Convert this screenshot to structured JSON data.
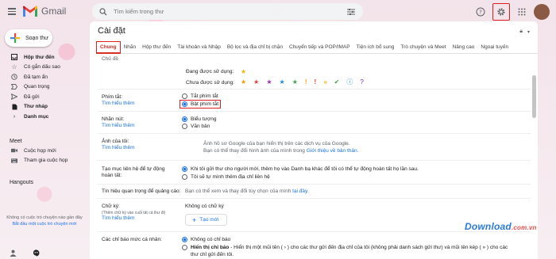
{
  "app": {
    "name": "Gmail"
  },
  "search": {
    "placeholder": "Tìm kiếm trong thư"
  },
  "sidebar": {
    "compose": "Soạn thư",
    "items": [
      {
        "label": "Hộp thư đến",
        "icon": "inbox-icon",
        "bold": true
      },
      {
        "label": "Có gắn dấu sao",
        "icon": "star-icon"
      },
      {
        "label": "Đã tạm ẩn",
        "icon": "clock-icon"
      },
      {
        "label": "Quan trọng",
        "icon": "important-icon"
      },
      {
        "label": "Đã gửi",
        "icon": "send-icon"
      },
      {
        "label": "Thư nháp",
        "icon": "draft-icon",
        "bold": true
      },
      {
        "label": "Danh mục",
        "icon": "chevron-right-icon",
        "bold": true
      }
    ],
    "meet": {
      "title": "Meet",
      "items": [
        {
          "label": "Cuộc họp mới",
          "icon": "video-icon"
        },
        {
          "label": "Tham gia cuộc họp",
          "icon": "keyboard-icon"
        }
      ]
    },
    "hangouts": {
      "title": "Hangouts",
      "empty": "Không có cuộc trò chuyện nào gần đây",
      "link": "Bắt đầu một cuộc trò chuyện mới"
    }
  },
  "settings": {
    "title": "Cài đặt",
    "tabs": [
      "Chung",
      "Nhãn",
      "Hộp thư đến",
      "Tài khoản và Nhập",
      "Bộ lọc và địa chỉ bị chặn",
      "Chuyển tiếp và POP/IMAP",
      "Tiện ích bổ sung",
      "Trò chuyện và Meet",
      "Nâng cao",
      "Ngoại tuyến"
    ],
    "active_tab": "Chung",
    "cutoff_text": "Chủ đề",
    "stars": {
      "in_use_label": "Đang được sử dụng:",
      "not_in_use_label": "Chưa được sử dụng:"
    },
    "shortcuts": {
      "label": "Phím tắt:",
      "learn_more": "Tìm hiểu thêm",
      "off": "Tắt phím tắt",
      "on": "Bật phím tắt"
    },
    "button_labels": {
      "label": "Nhãn nút:",
      "learn_more": "Tìm hiểu thêm",
      "icons": "Biểu tượng",
      "text": "Văn bản"
    },
    "my_picture": {
      "label": "Ảnh của tôi:",
      "learn_more": "Tìm hiểu thêm",
      "line1": "Ảnh hồ sơ Google của bạn hiển thị trên các dịch vụ của Google.",
      "line2_prefix": "Bạn có thể thay đổi hình ảnh của mình trong ",
      "line2_link": "Giới thiệu về bản thân."
    },
    "autocomplete": {
      "label": "Tạo mục liên hệ để tự động hoàn tất:",
      "opt1": "Khi tôi gửi thư cho người mới, thêm họ vào Danh bạ khác để tôi có thể tự động hoàn tất họ lần sau.",
      "opt2": "Tôi sẽ tự mình thêm địa chỉ liên hệ"
    },
    "ads": {
      "label": "Tín hiệu quan trọng để quảng cáo:",
      "text_prefix": "Bạn có thể xem và thay đổi tùy chọn của mình ",
      "link": "tại đây."
    },
    "signature": {
      "label": "Chữ ký:",
      "sub": "(Thêm chữ ký vào cuối tất cả thư đi)",
      "learn_more": "Tìm hiểu thêm",
      "none": "Không có chữ ký",
      "create": "Tạo mới"
    },
    "indicators": {
      "label": "Các chỉ báo mức cá nhân:",
      "opt1": "Không có chỉ báo",
      "opt2_title": "Hiển thị chỉ báo",
      "opt2_text": " - Hiển thị một mũi tên ( › ) cho các thư gửi đến địa chỉ của tôi (không phải danh sách gửi thư) và mũi tên kép ( » ) cho các thư chỉ gửi đến tôi."
    }
  },
  "watermark": {
    "text": "Download",
    "suffix": ".com.vn"
  },
  "colors": {
    "accent": "#1a73e8",
    "active_tab": "#d93025",
    "highlight_box": "#e02020"
  }
}
